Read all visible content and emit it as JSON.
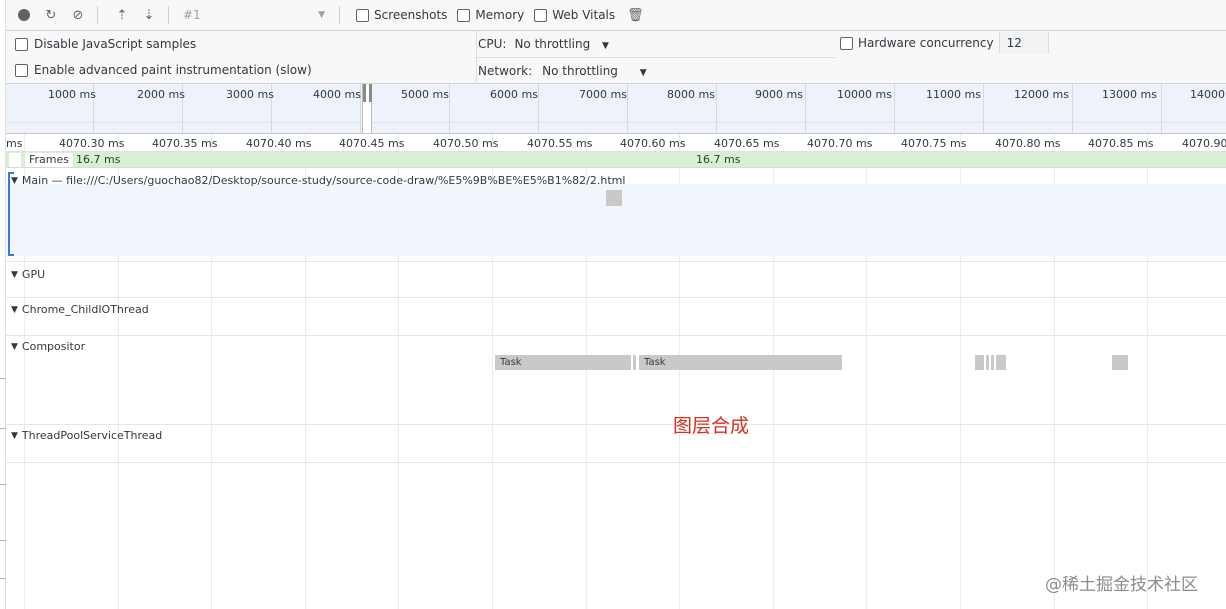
{
  "toolbar": {
    "profile_select": "#1",
    "screenshots_label": "Screenshots",
    "memory_label": "Memory",
    "web_vitals_label": "Web Vitals"
  },
  "settings": {
    "disable_js_samples": "Disable JavaScript samples",
    "advanced_paint": "Enable advanced paint instrumentation (slow)",
    "cpu_label": "CPU:",
    "cpu_value": "No throttling",
    "network_label": "Network:",
    "network_value": "No throttling",
    "hardware_concurrency_label": "Hardware concurrency",
    "hardware_concurrency_value": "12"
  },
  "overview": {
    "labels": [
      "1000 ms",
      "2000 ms",
      "3000 ms",
      "4000 ms",
      "5000 ms",
      "6000 ms",
      "7000 ms",
      "8000 ms",
      "9000 ms",
      "10000 ms",
      "11000 ms",
      "12000 ms",
      "13000 ms",
      "14000"
    ]
  },
  "ruler": {
    "labels": [
      "ms",
      "4070.30 ms",
      "4070.35 ms",
      "4070.40 ms",
      "4070.45 ms",
      "4070.50 ms",
      "4070.55 ms",
      "4070.60 ms",
      "4070.65 ms",
      "4070.70 ms",
      "4070.75 ms",
      "4070.80 ms",
      "4070.85 ms",
      "4070.90 ms"
    ]
  },
  "frames": {
    "label": "Frames",
    "frame_1": "16.7 ms",
    "frame_2": "16.7 ms"
  },
  "tracks": {
    "main": "Main — file:///C:/Users/guochao82/Desktop/source-study/source-code-draw/%E5%9B%BE%E5%B1%82/2.html",
    "gpu": "GPU",
    "child_io": "Chrome_ChildIOThread",
    "compositor": "Compositor",
    "thread_pool": "ThreadPoolServiceThread"
  },
  "compositor_tasks": {
    "task_1": "Task",
    "task_2": "Task"
  },
  "annotation": "图层合成",
  "watermark": "@稀土掘金技术社区",
  "colors": {
    "accent_blue": "#3d78cc",
    "frames_green": "#d7f0d1",
    "annotation_red": "#d9301f"
  }
}
